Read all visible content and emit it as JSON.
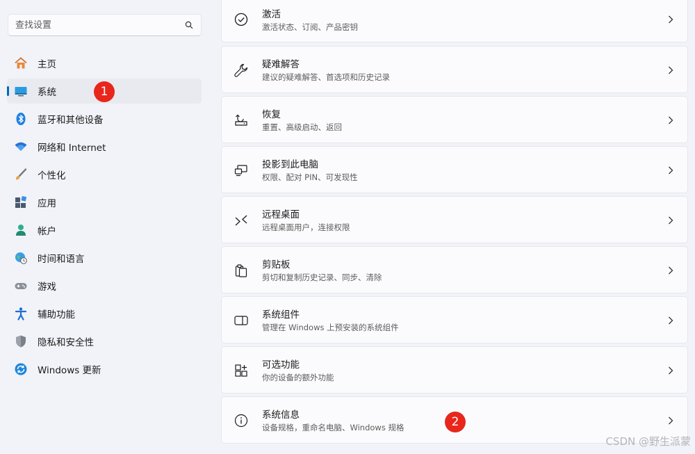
{
  "search": {
    "placeholder": "查找设置"
  },
  "sidebar": {
    "items": [
      {
        "label": "主页",
        "icon": "home-icon"
      },
      {
        "label": "系统",
        "icon": "system-icon",
        "selected": true
      },
      {
        "label": "蓝牙和其他设备",
        "icon": "bluetooth-icon"
      },
      {
        "label": "网络和 Internet",
        "icon": "wifi-icon"
      },
      {
        "label": "个性化",
        "icon": "brush-icon"
      },
      {
        "label": "应用",
        "icon": "apps-icon"
      },
      {
        "label": "帐户",
        "icon": "account-icon"
      },
      {
        "label": "时间和语言",
        "icon": "globe-clock-icon"
      },
      {
        "label": "游戏",
        "icon": "gamepad-icon"
      },
      {
        "label": "辅助功能",
        "icon": "accessibility-icon"
      },
      {
        "label": "隐私和安全性",
        "icon": "shield-icon"
      },
      {
        "label": "Windows 更新",
        "icon": "update-icon"
      }
    ]
  },
  "main": {
    "cards": [
      {
        "title": "激活",
        "subtitle": "激活状态、订阅、产品密钥",
        "icon": "check-circle-icon"
      },
      {
        "title": "疑难解答",
        "subtitle": "建议的疑难解答、首选项和历史记录",
        "icon": "wrench-icon"
      },
      {
        "title": "恢复",
        "subtitle": "重置、高级启动、返回",
        "icon": "recovery-icon"
      },
      {
        "title": "投影到此电脑",
        "subtitle": "权限、配对 PIN、可发现性",
        "icon": "project-icon"
      },
      {
        "title": "远程桌面",
        "subtitle": "远程桌面用户，连接权限",
        "icon": "remote-desktop-icon"
      },
      {
        "title": "剪贴板",
        "subtitle": "剪切和复制历史记录、同步、清除",
        "icon": "clipboard-icon"
      },
      {
        "title": "系统组件",
        "subtitle": "管理在 Windows 上预安装的系统组件",
        "icon": "system-components-icon"
      },
      {
        "title": "可选功能",
        "subtitle": "你的设备的额外功能",
        "icon": "optional-features-icon"
      },
      {
        "title": "系统信息",
        "subtitle": "设备规格，重命名电脑、Windows 规格",
        "icon": "info-icon"
      }
    ]
  },
  "annotations": {
    "badge1": "1",
    "badge2": "2"
  },
  "watermark": "CSDN @野生派蒙",
  "colors": {
    "accent": "#0067c0",
    "badge": "#e8261c"
  }
}
